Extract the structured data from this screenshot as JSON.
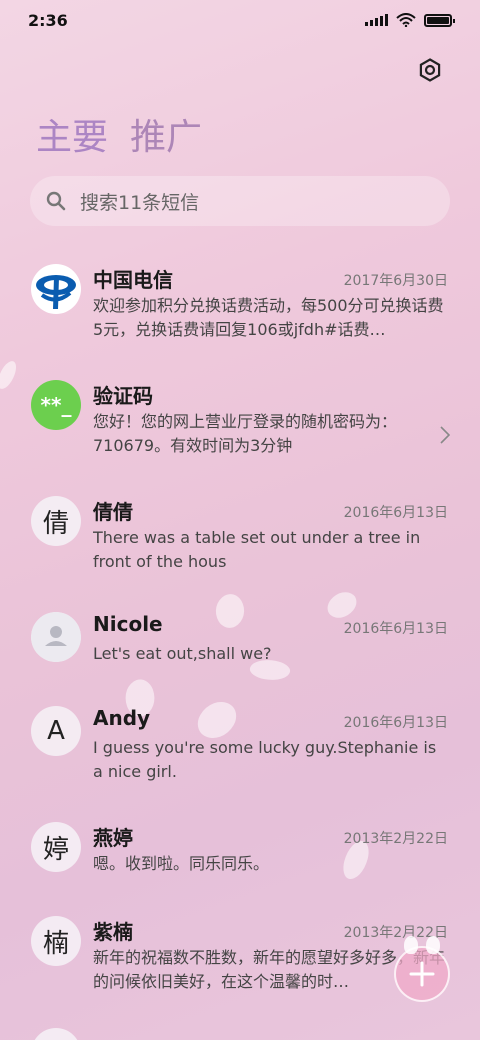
{
  "status": {
    "time": "2:36"
  },
  "tabs": [
    {
      "label": "主要"
    },
    {
      "label": "推广"
    }
  ],
  "search": {
    "placeholder": "搜索11条短信"
  },
  "conversations": [
    {
      "name": "中国电信",
      "date": "2017年6月30日",
      "message": "欢迎参加积分兑换话费活动，每500分可兑换话费5元，兑换话费请回复106或jfdh#话费…",
      "avatar_type": "logo",
      "avatar_icon": "china-telecom-logo"
    },
    {
      "name": "验证码",
      "date": "",
      "message": "您好！您的网上营业厅登录的随机密码为：710679。有效时间为3分钟",
      "avatar_type": "badge",
      "avatar_text": "**_",
      "avatar_color": "#6ccf4e"
    },
    {
      "name": "倩倩",
      "date": "2016年6月13日",
      "message": "There was a table set out under a tree in front of the hous",
      "avatar_type": "char",
      "avatar_text": "倩"
    },
    {
      "name": "Nicole",
      "date": "2016年6月13日",
      "message": "Let's eat out,shall we?",
      "avatar_type": "icon",
      "avatar_icon": "person-icon"
    },
    {
      "name": "Andy",
      "date": "2016年6月13日",
      "message": "I guess you're some lucky guy.Stephanie is a nice girl.",
      "avatar_type": "char",
      "avatar_text": "A"
    },
    {
      "name": "燕婷",
      "date": "2013年2月22日",
      "message": "嗯。收到啦。同乐同乐。",
      "avatar_type": "char",
      "avatar_text": "婷"
    },
    {
      "name": "紫楠",
      "date": "2013年2月22日",
      "message": "新年的祝福数不胜数，新年的愿望好多好多，新年的问候依旧美好，在这个温馨的时…",
      "avatar_type": "char",
      "avatar_text": "楠"
    }
  ],
  "colors": {
    "accent_tab": "#a078be",
    "verification_badge": "#6ccf4e",
    "telecom_blue": "#0a5cb0"
  }
}
